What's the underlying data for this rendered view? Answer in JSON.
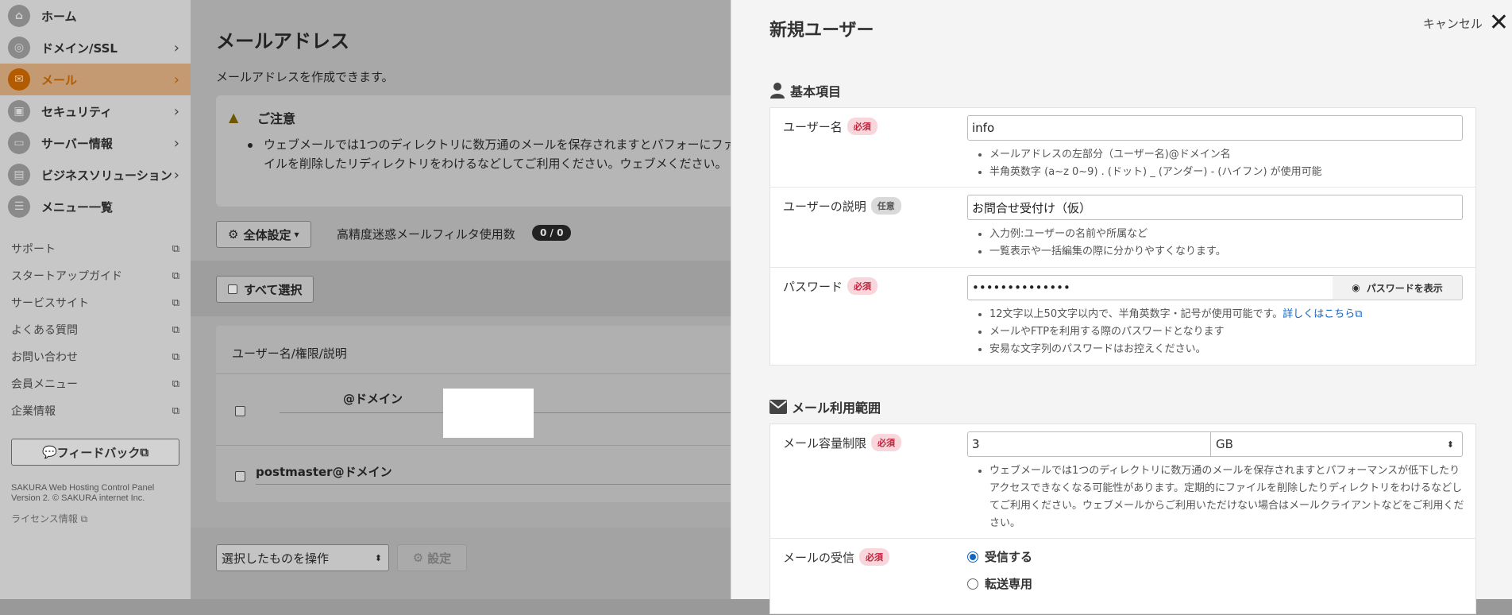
{
  "sidebar": {
    "nav": [
      {
        "label": "ホーム",
        "icon": "home-icon",
        "chevron": false
      },
      {
        "label": "ドメイン/SSL",
        "icon": "globe-icon",
        "chevron": true
      },
      {
        "label": "メール",
        "icon": "mail-icon",
        "chevron": true,
        "active": true
      },
      {
        "label": "セキュリティ",
        "icon": "lock-icon",
        "chevron": true
      },
      {
        "label": "サーバー情報",
        "icon": "server-icon",
        "chevron": true
      },
      {
        "label": "ビジネスソリューション",
        "icon": "briefcase-icon",
        "chevron": true
      },
      {
        "label": "メニュー一覧",
        "icon": "list-icon",
        "chevron": false
      }
    ],
    "links": [
      "サポート",
      "スタートアップガイド",
      "サービスサイト",
      "よくある質問",
      "お問い合わせ",
      "会員メニュー",
      "企業情報"
    ],
    "feedback": "フィードバック",
    "copyright_line1": "SAKURA Web Hosting Control Panel",
    "copyright_line2": "Version 2. © SAKURA internet Inc.",
    "license": "ライセンス情報"
  },
  "main": {
    "title": "メールアドレス",
    "subtitle": "メールアドレスを作成できます。",
    "notice_title": "ご注意",
    "notice_body": "ウェブメールでは1つのディレクトリに数万通のメールを保存されますとパフォーにファイルを削除したリディレクトリをわけるなどしてご利用ください。ウェブメください。",
    "settings_button": "全体設定",
    "filter_label": "高精度迷惑メールフィルタ使用数",
    "filter_count": "0 / 0",
    "select_all": "すべて選択",
    "column_header": "ユーザー名/権限/説明",
    "rows": [
      "@ドメイン",
      "postmaster@ドメイン"
    ],
    "bulk_select": "選択したものを操作",
    "bulk_settings": "設定"
  },
  "panel": {
    "title": "新規ユーザー",
    "cancel": "キャンセル",
    "section_basic": "基本項目",
    "section_mail": "メール利用範囲",
    "required": "必須",
    "optional": "任意",
    "username_label": "ユーザー名",
    "username_value": "info",
    "username_hints": [
      "メールアドレスの左部分（ユーザー名)@ドメイン名",
      "半角英数字 (a~z 0~9) . (ドット) _ (アンダー) - (ハイフン) が使用可能"
    ],
    "desc_label": "ユーザーの説明",
    "desc_value": "お問合せ受付け（仮）",
    "desc_hints": [
      "入力例:ユーザーの名前や所属など",
      "一覧表示や一括編集の際に分かりやすくなります。"
    ],
    "password_label": "パスワード",
    "password_value": "••••••••••••••",
    "show_password": "パスワードを表示",
    "password_hint1": "12文字以上50文字以内で、半角英数字・記号が使用可能です。",
    "password_hint1_link": "詳しくはこちら",
    "password_hint2": "メールやFTPを利用する際のパスワードとなります",
    "password_hint3": "安易な文字列のパスワードはお控えください。",
    "quota_label": "メール容量制限",
    "quota_value": "3",
    "quota_unit": "GB",
    "quota_hint": "ウェブメールでは1つのディレクトリに数万通のメールを保存されますとパフォーマンスが低下したりアクセスできなくなる可能性があります。定期的にファイルを削除したりディレクトリをわけるなどしてご利用ください。ウェブメールからご利用いただけない場合はメールクライアントなどをご利用ください。",
    "receive_label": "メールの受信",
    "receive_option1": "受信する",
    "receive_option2": "転送専用"
  }
}
